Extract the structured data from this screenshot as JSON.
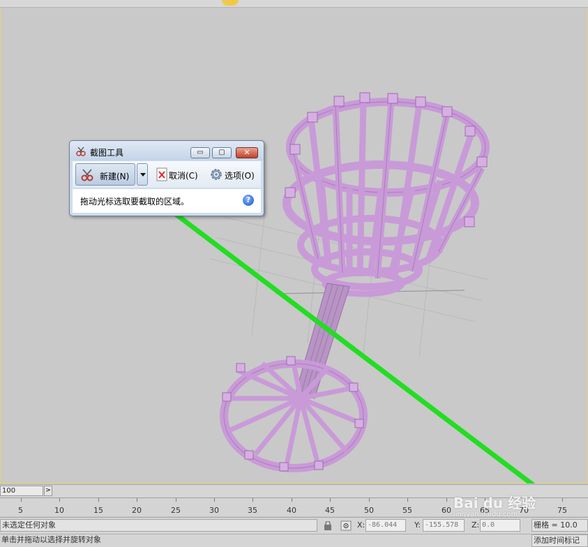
{
  "snipping_tool": {
    "title": "截图工具",
    "new_label": "新建(N)",
    "cancel_label": "取消(C)",
    "options_label": "选项(O)",
    "hint": "拖动光标选取要截取的区域。",
    "help_glyph": "?",
    "min_glyph": "▭",
    "max_glyph": "▢",
    "close_glyph": "✕"
  },
  "timeline": {
    "frame_counter": "100",
    "next_glyph": ">",
    "ticks": [
      "5",
      "10",
      "15",
      "20",
      "25",
      "30",
      "35",
      "40",
      "45",
      "50",
      "55",
      "60",
      "65",
      "70",
      "75"
    ]
  },
  "status": {
    "selection_text": "未选定任何对象",
    "prompt_text": "单击并拖动以选择并旋转对象",
    "x_label": "X:",
    "x_value": "-86.044",
    "y_label": "Y:",
    "y_value": "-155.578",
    "z_label": "Z:",
    "z_value": "0.0",
    "grid_label": "栅格 = 10.0",
    "add_time_tag": "添加时间标记"
  },
  "watermark": {
    "brand": "Bai du 经验",
    "url": "jingyan.baidu.com"
  },
  "colors": {
    "viewport_bg": "#c9c9c9",
    "model": "#c99ad8",
    "arrow": "#22dd22"
  }
}
